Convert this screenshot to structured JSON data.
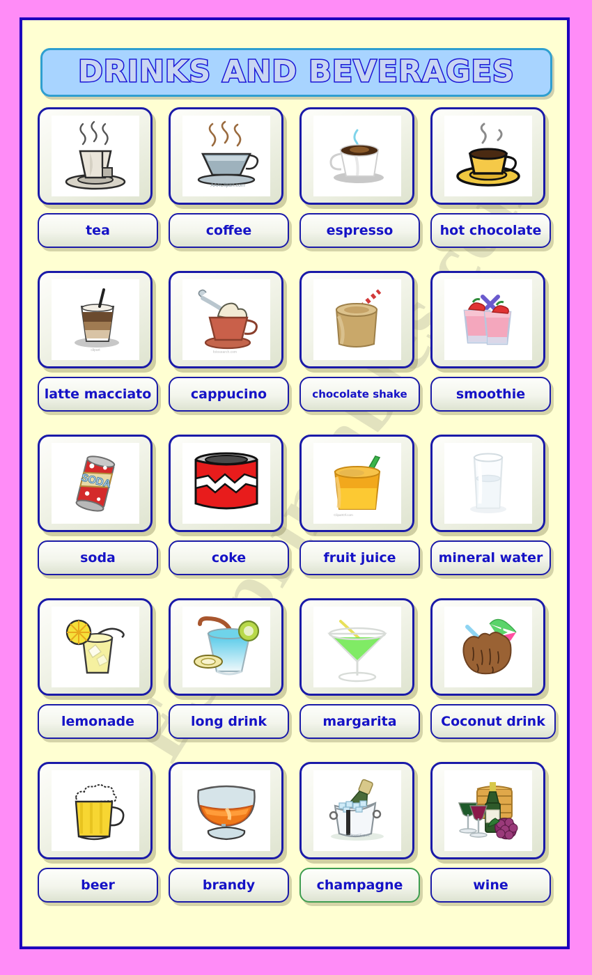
{
  "page": {
    "title": "DRINKS AND BEVERAGES",
    "watermark": "ESLprintables.com",
    "colors": {
      "outer_background": "#ff8cf7",
      "sheet_background": "#ffffd2",
      "sheet_border": "#1d00bd",
      "banner_background": "#a8d4ff",
      "banner_border": "#2f9fd0",
      "title_outline": "#1a15d6",
      "label_text": "#1512c6",
      "card_border": "#1a1aa8",
      "champagne_label_border": "#3f9d50"
    }
  },
  "grid": {
    "columns": 4,
    "rows": 5,
    "items": [
      {
        "label": "tea",
        "icon": "tea-cup-icon",
        "label_size": "normal"
      },
      {
        "label": "coffee",
        "icon": "coffee-cup-icon",
        "label_size": "normal"
      },
      {
        "label": "espresso",
        "icon": "espresso-cup-icon",
        "label_size": "normal"
      },
      {
        "label": "hot chocolate",
        "icon": "hot-chocolate-icon",
        "label_size": "normal"
      },
      {
        "label": "latte macciato",
        "icon": "latte-glass-icon",
        "label_size": "normal"
      },
      {
        "label": "cappucino",
        "icon": "cappucino-cup-icon",
        "label_size": "normal"
      },
      {
        "label": "chocolate shake",
        "icon": "chocolate-shake-icon",
        "label_size": "small"
      },
      {
        "label": "smoothie",
        "icon": "smoothie-glasses-icon",
        "label_size": "normal"
      },
      {
        "label": "soda",
        "icon": "soda-can-icon",
        "label_size": "normal"
      },
      {
        "label": "coke",
        "icon": "coke-can-icon",
        "label_size": "normal"
      },
      {
        "label": "fruit juice",
        "icon": "fruit-juice-icon",
        "label_size": "normal"
      },
      {
        "label": "mineral water",
        "icon": "water-glass-icon",
        "label_size": "normal"
      },
      {
        "label": "lemonade",
        "icon": "lemonade-glass-icon",
        "label_size": "normal"
      },
      {
        "label": "long drink",
        "icon": "long-drink-icon",
        "label_size": "normal"
      },
      {
        "label": "margarita",
        "icon": "margarita-glass-icon",
        "label_size": "normal"
      },
      {
        "label": "Coconut drink",
        "icon": "coconut-drink-icon",
        "label_size": "normal"
      },
      {
        "label": "beer",
        "icon": "beer-mug-icon",
        "label_size": "normal"
      },
      {
        "label": "brandy",
        "icon": "brandy-snifter-icon",
        "label_size": "normal"
      },
      {
        "label": "champagne",
        "icon": "champagne-bucket-icon",
        "label_size": "normal"
      },
      {
        "label": "wine",
        "icon": "wine-bottle-icon",
        "label_size": "normal"
      }
    ]
  }
}
